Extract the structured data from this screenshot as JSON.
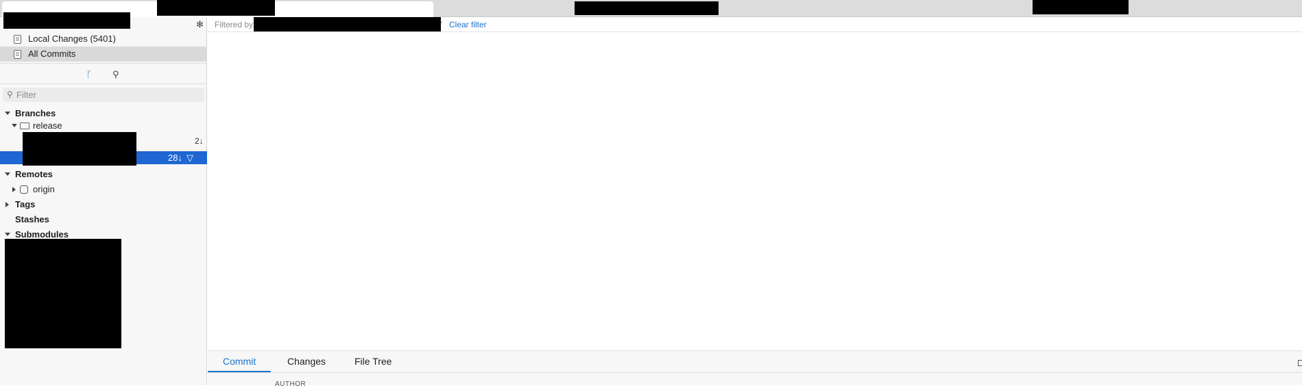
{
  "sidebar": {
    "nav": [
      {
        "label": "Local Changes (5401)",
        "icon": "local-changes-icon"
      },
      {
        "label": "All Commits",
        "icon": "all-commits-icon"
      }
    ],
    "filter_placeholder": "Filter",
    "tree": {
      "branches_label": "Branches",
      "release_label": "release",
      "local_count": "2↓",
      "selected_count": "28↓",
      "remotes_label": "Remotes",
      "origin_label": "origin",
      "tags_label": "Tags",
      "stashes_label": "Stashes",
      "submodules_label": "Submodules"
    }
  },
  "main": {
    "filter_prefix": "Filtered by",
    "filter_quote": "'",
    "clear_filter": "Clear filter"
  },
  "details": {
    "tabs": [
      "Commit",
      "Changes",
      "File Tree"
    ],
    "active_tab": "Commit",
    "author_label": "AUTHOR"
  },
  "colors": {
    "accent": "#1a73c9",
    "selection": "#1f66d2"
  }
}
